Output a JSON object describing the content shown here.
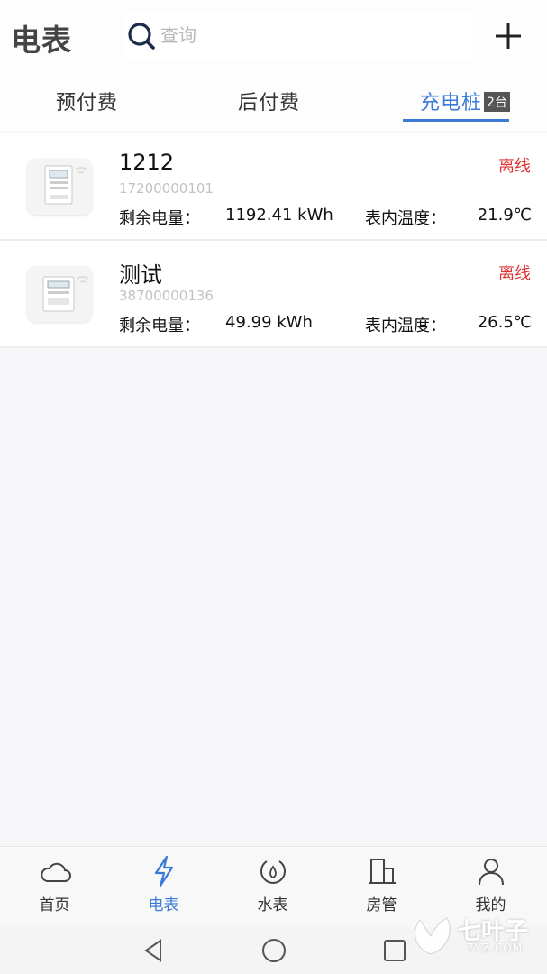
{
  "header": {
    "title": "电表",
    "search_placeholder": "查询"
  },
  "tabs": [
    {
      "label": "预付费",
      "active": false
    },
    {
      "label": "后付费",
      "active": false
    },
    {
      "label": "充电桩",
      "active": true,
      "badge": "2台"
    }
  ],
  "meters": [
    {
      "name": "1212",
      "id": "17200000101",
      "status": "离线",
      "remaining_label": "剩余电量：",
      "remaining_value": "1192.41 kWh",
      "temp_label": "表内温度：",
      "temp_value": "21.9℃"
    },
    {
      "name": "测试",
      "id": "38700000136",
      "status": "离线",
      "remaining_label": "剩余电量：",
      "remaining_value": "49.99 kWh",
      "temp_label": "表内温度：",
      "temp_value": "26.5℃"
    }
  ],
  "bottom_nav": [
    {
      "label": "首页",
      "icon": "cloud-icon",
      "active": false
    },
    {
      "label": "电表",
      "icon": "lightning-icon",
      "active": true
    },
    {
      "label": "水表",
      "icon": "water-drop-icon",
      "active": false
    },
    {
      "label": "房管",
      "icon": "building-icon",
      "active": false
    },
    {
      "label": "我的",
      "icon": "person-icon",
      "active": false
    }
  ],
  "watermark": {
    "text": "七叶子",
    "sub": "7YZ.COM"
  },
  "colors": {
    "accent": "#3a7bd5",
    "offline": "#dd3333",
    "badge": "#555555"
  }
}
